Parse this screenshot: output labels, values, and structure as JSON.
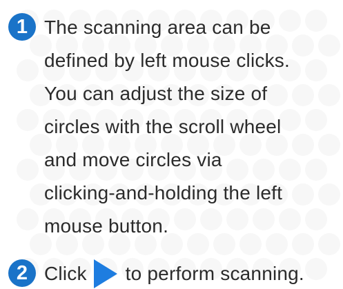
{
  "steps": [
    {
      "number": "1",
      "lines": [
        "The scanning area can be",
        "defined by left mouse clicks.",
        "You can adjust the size of",
        "circles with the scroll wheel",
        "and move circles via",
        "clicking-and-holding the left",
        "mouse button."
      ]
    },
    {
      "number": "2",
      "text_before": "Click",
      "icon": "play-icon",
      "text_after": "to perform scanning."
    }
  ],
  "colors": {
    "badge": "#1a73c8",
    "play_icon": "#1e7de0",
    "text": "#2b2b2b",
    "pattern": "#f7f7f7"
  }
}
